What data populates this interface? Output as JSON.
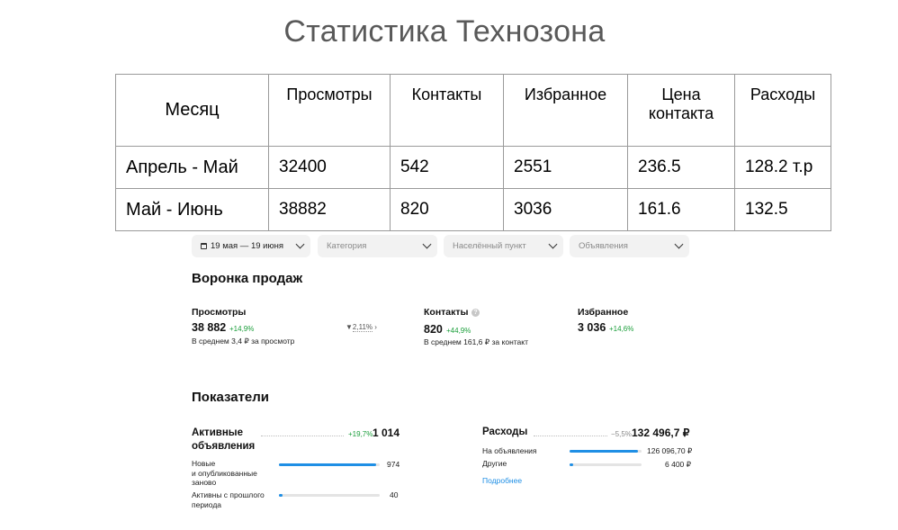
{
  "title": "Статистика Технозона",
  "table": {
    "headers": [
      "Месяц",
      "Просмотры",
      "Контакты",
      "Избранное",
      "Цена\nконтакта",
      "Расходы"
    ],
    "rows": [
      [
        "Апрель - Май",
        "32400",
        "542",
        "2551",
        "236.5",
        "128.2 т.р"
      ],
      [
        "Май - Июнь",
        "38882",
        "820",
        "3036",
        "161.6",
        "132.5"
      ]
    ]
  },
  "filters": {
    "date": "19 мая — 19 июня",
    "category": "Категория",
    "locality": "Населённый пункт",
    "ads": "Объявления"
  },
  "funnel": {
    "title": "Воронка продаж",
    "views": {
      "label": "Просмотры",
      "value": "38 882",
      "delta": "+14,9%",
      "note": "В среднем 3,4 ₽ за просмотр"
    },
    "conversion": "2,11%",
    "contacts": {
      "label": "Контакты",
      "help": "?",
      "value": "820",
      "delta": "+44,9%",
      "note": "В среднем 161,6 ₽ за контакт"
    },
    "favorites": {
      "label": "Избранное",
      "value": "3 036",
      "delta": "+14,6%"
    }
  },
  "indicators": {
    "title": "Показатели",
    "active": {
      "label": "Активные\nобъявления",
      "delta": "+19,7%",
      "value": "1 014",
      "rows": [
        {
          "label": "Новые\nи опубликованные\nзаново",
          "value": "974",
          "share": 0.96
        },
        {
          "label": "Активны с прошлого\nпериода",
          "value": "40",
          "share": 0.04
        }
      ]
    },
    "expenses": {
      "label": "Расходы",
      "delta": "−5,5%",
      "value": "132 496,7 ₽",
      "rows": [
        {
          "label": "На объявления",
          "value": "126 096,70 ₽",
          "share": 0.95
        },
        {
          "label": "Другие",
          "value": "6 400 ₽",
          "share": 0.05
        }
      ],
      "more": "Подробнее"
    }
  },
  "colors": {
    "accent": "#1f8fe5",
    "positive": "#1a9e3a",
    "title": "#595959"
  }
}
